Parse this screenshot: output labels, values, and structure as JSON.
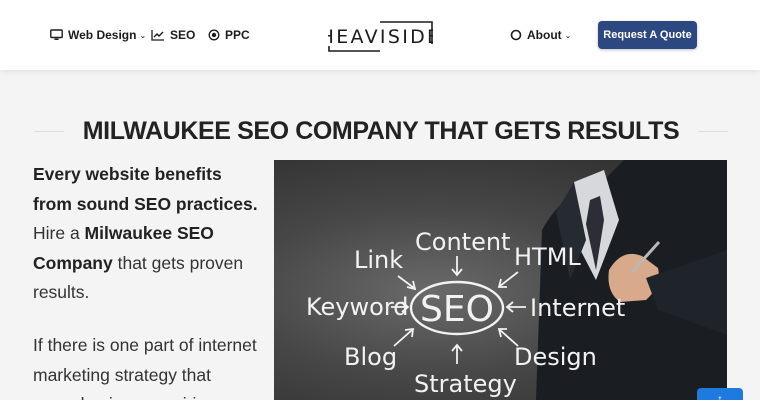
{
  "header": {
    "nav_left": [
      {
        "label": "Web Design",
        "icon": "monitor-icon",
        "has_dropdown": true
      },
      {
        "label": "SEO",
        "icon": "chart-line-icon",
        "has_dropdown": false
      },
      {
        "label": "PPC",
        "icon": "target-icon",
        "has_dropdown": false
      }
    ],
    "logo_text": "HEAVISIDE",
    "nav_right": [
      {
        "label": "About",
        "icon": "circle-icon",
        "has_dropdown": true
      }
    ],
    "cta_label": "Request A Quote"
  },
  "main": {
    "headline": "MILWAUKEE SEO COMPANY THAT GETS RESULTS",
    "intro": {
      "bold_lead": "Every website benefits from sound SEO practices.",
      "text_1": " Hire a ",
      "bold_company": "Milwaukee SEO Company",
      "text_2": " that gets proven results."
    },
    "paragraph_2": "If there is one part of internet marketing strategy that every business aspiring"
  },
  "hero_image": {
    "center_word": "SEO",
    "words": [
      "Content",
      "Link",
      "HTML",
      "Keyword",
      "Internet",
      "Blog",
      "Design",
      "Strategy"
    ]
  },
  "colors": {
    "cta_background": "#2d4880",
    "page_background": "#f4f4f4",
    "scroll_button": "#1f7ae0"
  }
}
